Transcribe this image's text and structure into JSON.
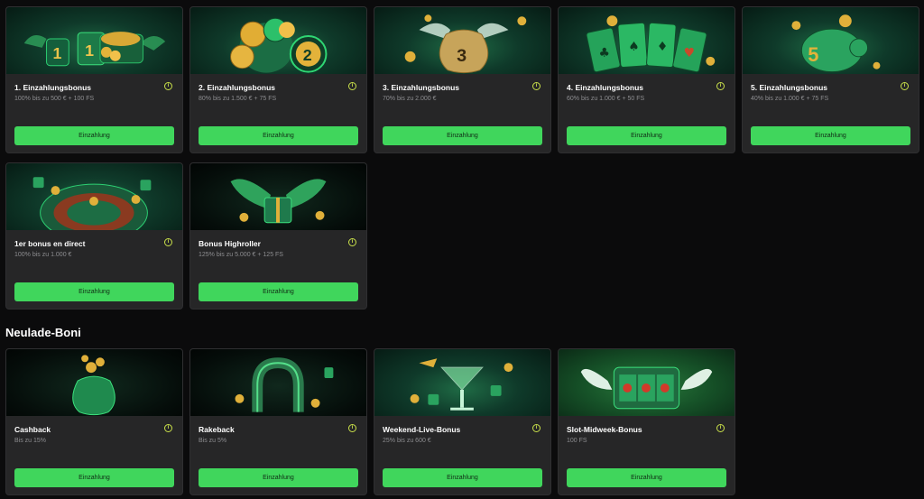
{
  "welcome_bonuses": [
    {
      "title": "1. Einzahlungsbonus",
      "subtitle": "100% bis zu 500 € + 100 FS",
      "button": "Einzahlung",
      "art": "chest-art"
    },
    {
      "title": "2. Einzahlungsbonus",
      "subtitle": "80% bis zu 1.500 € + 75 FS",
      "button": "Einzahlung",
      "art": "chips-art"
    },
    {
      "title": "3. Einzahlungsbonus",
      "subtitle": "70% bis zu 2.000 €",
      "button": "Einzahlung",
      "art": "money-bag-art"
    },
    {
      "title": "4. Einzahlungsbonus",
      "subtitle": "60% bis zu 1.000 € + 50 FS",
      "button": "Einzahlung",
      "art": "cards-art"
    },
    {
      "title": "5. Einzahlungsbonus",
      "subtitle": "40% bis zu 1.000 € + 75 FS",
      "button": "Einzahlung",
      "art": "piggy-bank-art"
    },
    {
      "title": "1er bonus en direct",
      "subtitle": "100% bis zu 1.000 €",
      "button": "Einzahlung",
      "art": "roulette-art"
    },
    {
      "title": "Bonus Highroller",
      "subtitle": "125% bis zu 5.000 € + 125 FS",
      "button": "Einzahlung",
      "art": "winged-gift-art"
    }
  ],
  "reload_section_title": "Neulade-Boni",
  "reload_bonuses": [
    {
      "title": "Cashback",
      "subtitle": "Bis zu 15%",
      "button": "Einzahlung",
      "art": "coin-bag-art"
    },
    {
      "title": "Rakeback",
      "subtitle": "Bis zu 5%",
      "button": "Einzahlung",
      "art": "horseshoe-art"
    },
    {
      "title": "Weekend-Live-Bonus",
      "subtitle": "25% bis zu 600 €",
      "button": "Einzahlung",
      "art": "cocktail-art"
    },
    {
      "title": "Slot-Midweek-Bonus",
      "subtitle": "100 FS",
      "button": "Einzahlung",
      "art": "slot-machine-art"
    }
  ],
  "info_icon": "i",
  "colors": {
    "accent": "#40d65c",
    "card": "#262627",
    "info": "#c9e04a"
  }
}
